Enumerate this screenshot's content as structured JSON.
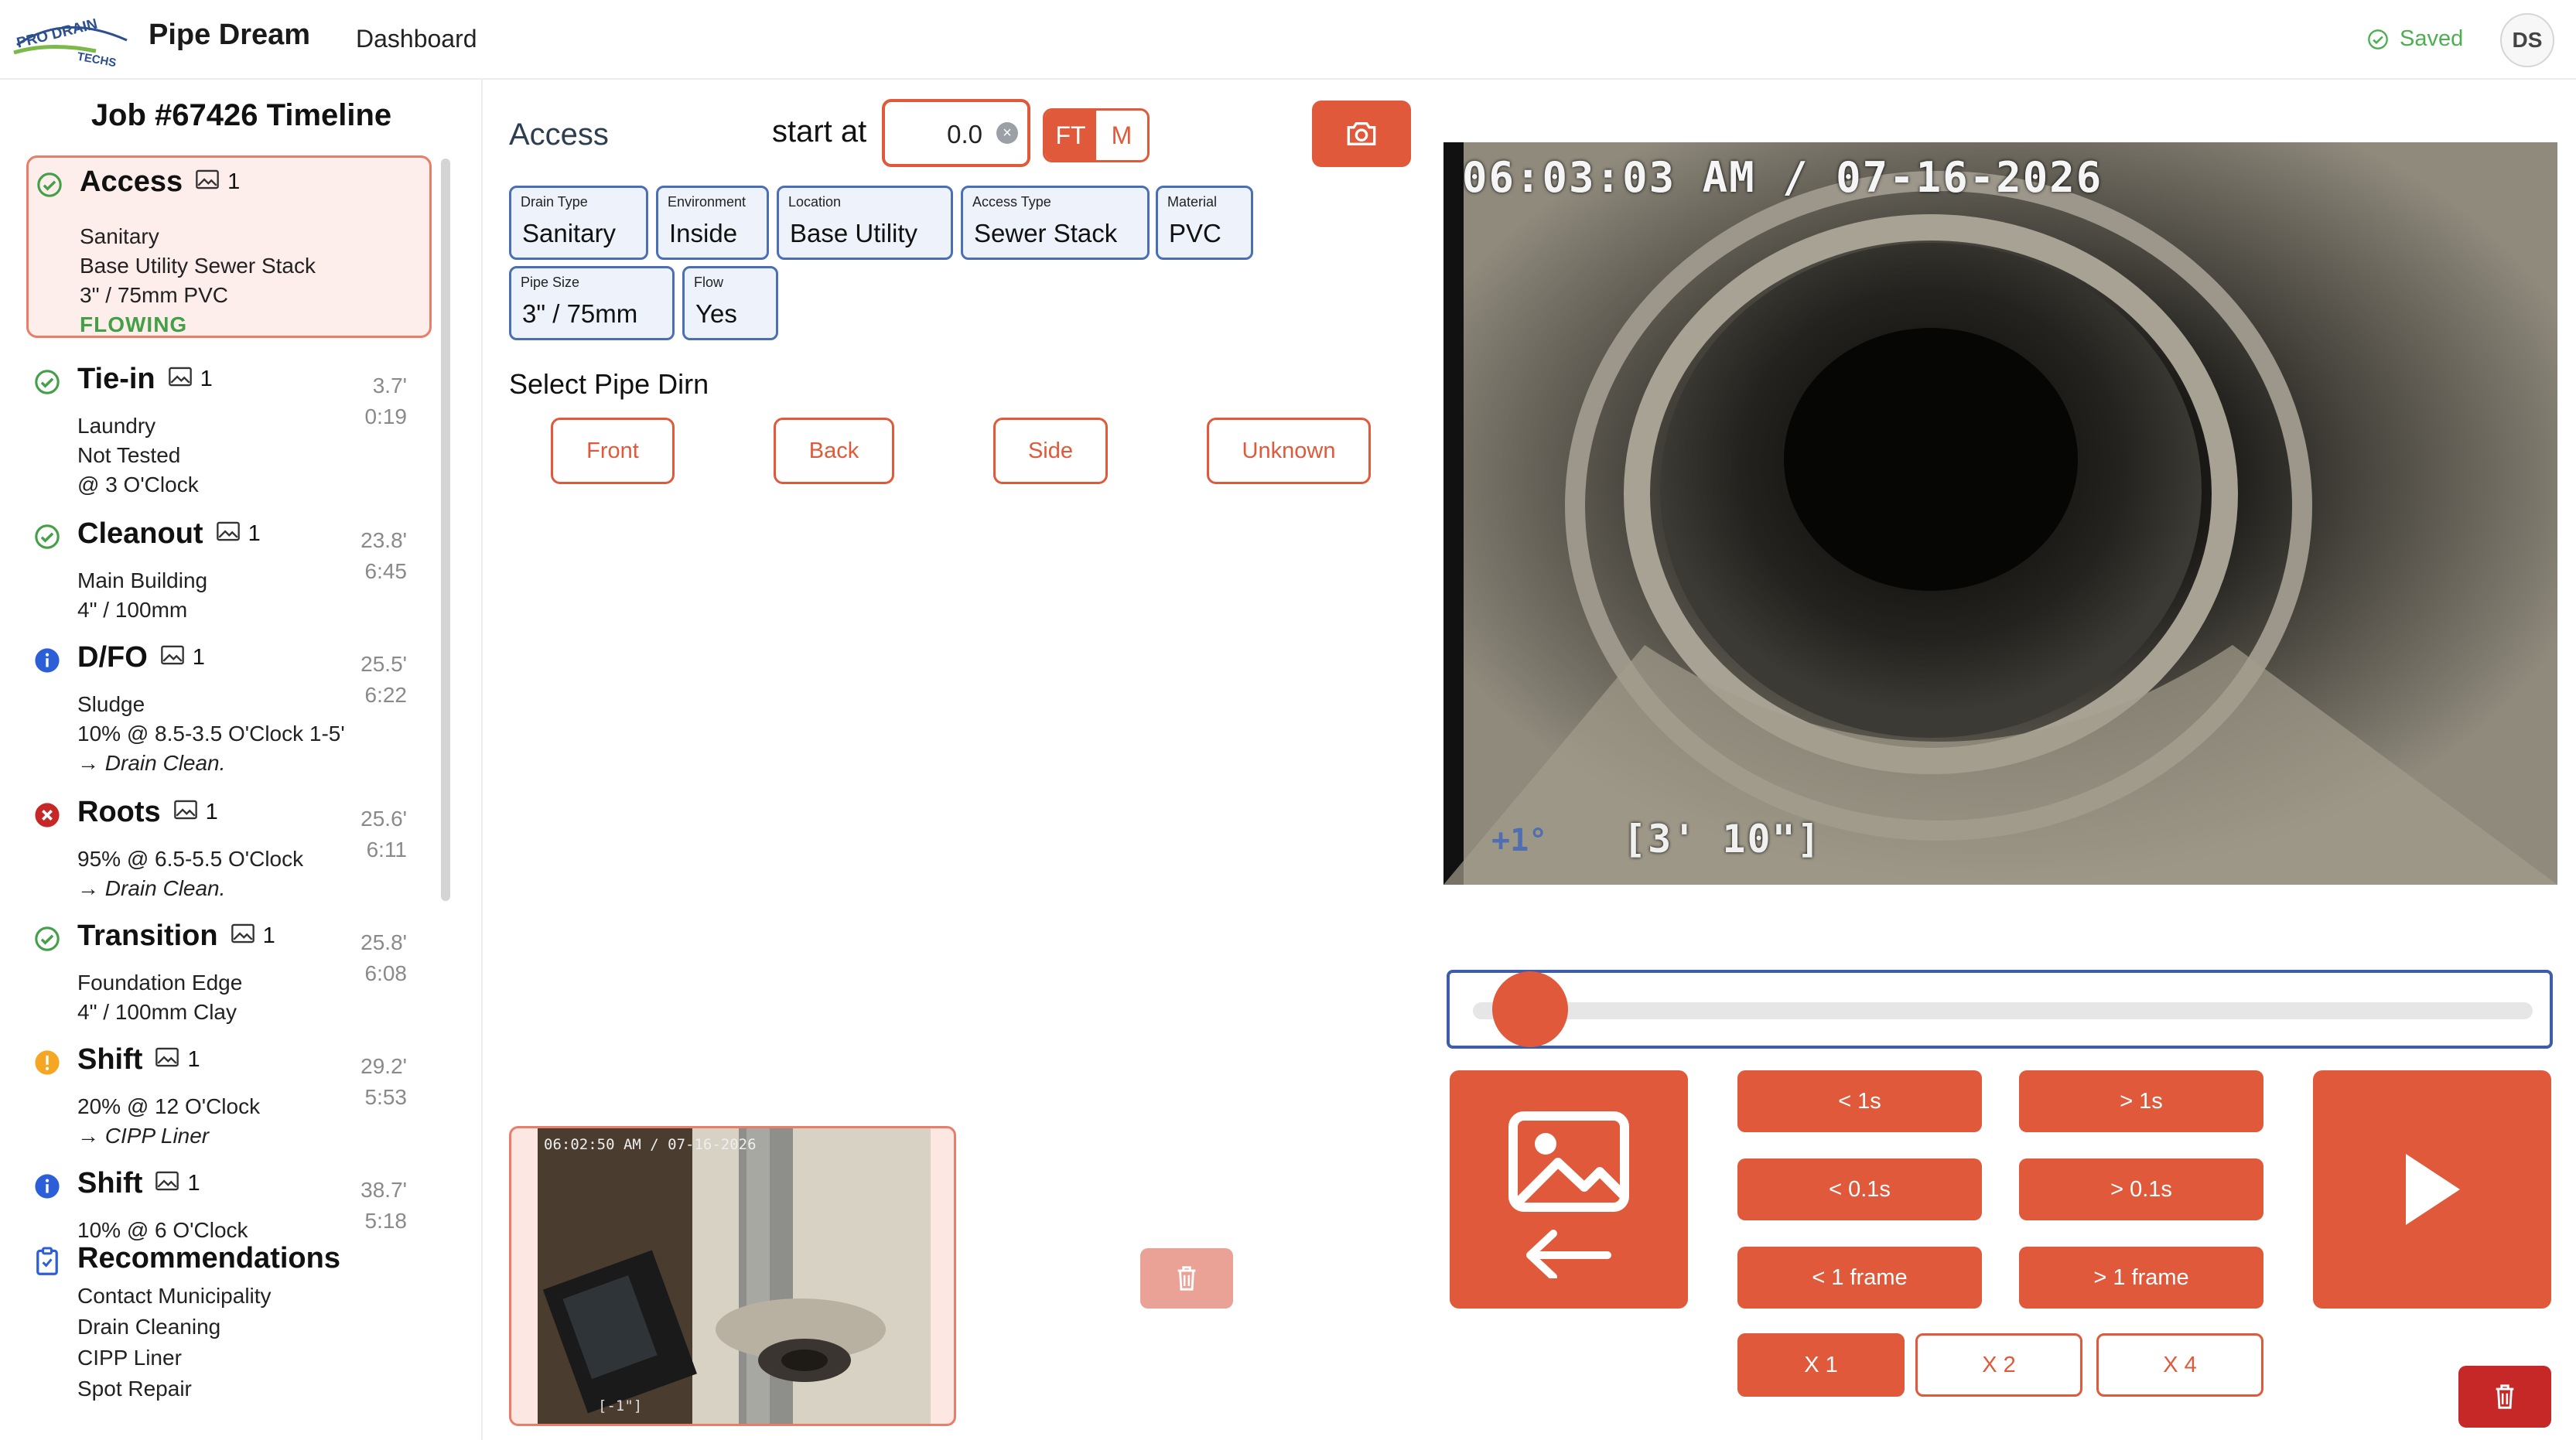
{
  "app": {
    "logo_text": "PRO DRAIN TECHS",
    "title": "Pipe Dream",
    "nav": "Dashboard",
    "status": "Saved",
    "user_initials": "DS"
  },
  "colors": {
    "accent": "#e0593a",
    "selected_bg": "#fdeeec",
    "attr_border": "#4a6fb5",
    "ok": "#43a047",
    "info": "#2b5ed7",
    "error": "#c62828",
    "warn": "#f5a623"
  },
  "timeline": {
    "title": "Job #67426 Timeline",
    "events": [
      {
        "name": "Access",
        "status_icon": "check-circle-icon",
        "photos": "1",
        "lines": [
          "Sanitary",
          "Base Utility Sewer Stack",
          "3\" / 75mm PVC"
        ],
        "state": "FLOWING",
        "dist": "",
        "time": "",
        "selected": true
      },
      {
        "name": "Tie-in",
        "status_icon": "check-circle-icon",
        "photos": "1",
        "lines": [
          "Laundry",
          "Not Tested",
          "@ 3 O'Clock"
        ],
        "dist": "3.7'",
        "time": "0:19"
      },
      {
        "name": "Cleanout",
        "status_icon": "check-circle-icon",
        "photos": "1",
        "lines": [
          "Main Building",
          "4\" / 100mm"
        ],
        "dist": "23.8'",
        "time": "6:45"
      },
      {
        "name": "D/FO",
        "status_icon": "info-circle-icon",
        "photos": "1",
        "lines": [
          "Sludge",
          "10% @ 8.5-3.5 O'Clock 1-5'",
          "→ Drain Clean."
        ],
        "dist": "25.5'",
        "time": "6:22"
      },
      {
        "name": "Roots",
        "status_icon": "x-circle-icon",
        "photos": "1",
        "lines": [
          "95% @ 6.5-5.5 O'Clock",
          "→ Drain Clean."
        ],
        "dist": "25.6'",
        "time": "6:11"
      },
      {
        "name": "Transition",
        "status_icon": "check-circle-icon",
        "photos": "1",
        "lines": [
          "Foundation Edge",
          "4\" / 100mm Clay"
        ],
        "dist": "25.8'",
        "time": "6:08"
      },
      {
        "name": "Shift",
        "status_icon": "warning-circle-icon",
        "photos": "1",
        "lines": [
          "20% @ 12 O'Clock",
          "→ CIPP Liner"
        ],
        "dist": "29.2'",
        "time": "5:53"
      },
      {
        "name": "Shift",
        "status_icon": "info-circle-icon",
        "photos": "1",
        "lines": [
          "10% @ 6 O'Clock"
        ],
        "dist": "38.7'",
        "time": "5:18"
      }
    ],
    "recommendations": {
      "title": "Recommendations",
      "items": [
        "Contact Municipality",
        "Drain Cleaning",
        "CIPP Liner",
        "Spot Repair"
      ]
    }
  },
  "editor": {
    "title": "Access",
    "start_at_label": "start at",
    "start_at_value": "0.0",
    "units": {
      "ft": "FT",
      "m": "M",
      "active": "FT"
    },
    "attributes": [
      {
        "key": "Drain Type",
        "value": "Sanitary"
      },
      {
        "key": "Environment",
        "value": "Inside"
      },
      {
        "key": "Location",
        "value": "Base Utility"
      },
      {
        "key": "Access Type",
        "value": "Sewer Stack"
      },
      {
        "key": "Material",
        "value": "PVC"
      },
      {
        "key": "Pipe Size",
        "value": "3\" / 75mm"
      },
      {
        "key": "Flow",
        "value": "Yes"
      }
    ],
    "pipe_dirn_label": "Select Pipe Dirn",
    "directions": [
      "Front",
      "Back",
      "Side",
      "Unknown"
    ],
    "snapshot": {
      "timestamp": "06:02:50 AM / 07-16-2026",
      "footage": "[-1\"]"
    }
  },
  "video": {
    "timestamp": "06:03:03 AM / 07-16-2026",
    "tilt": "+1°",
    "footage": "[3' 10\"]",
    "progress": 0.02
  },
  "controls": {
    "back_1s": "< 1s",
    "fwd_1s": "> 1s",
    "back_01s": "< 0.1s",
    "fwd_01s": "> 0.1s",
    "back_frame": "< 1 frame",
    "fwd_frame": "> 1 frame",
    "speeds": [
      "X 1",
      "X 2",
      "X 4"
    ],
    "active_speed": "X 1"
  }
}
